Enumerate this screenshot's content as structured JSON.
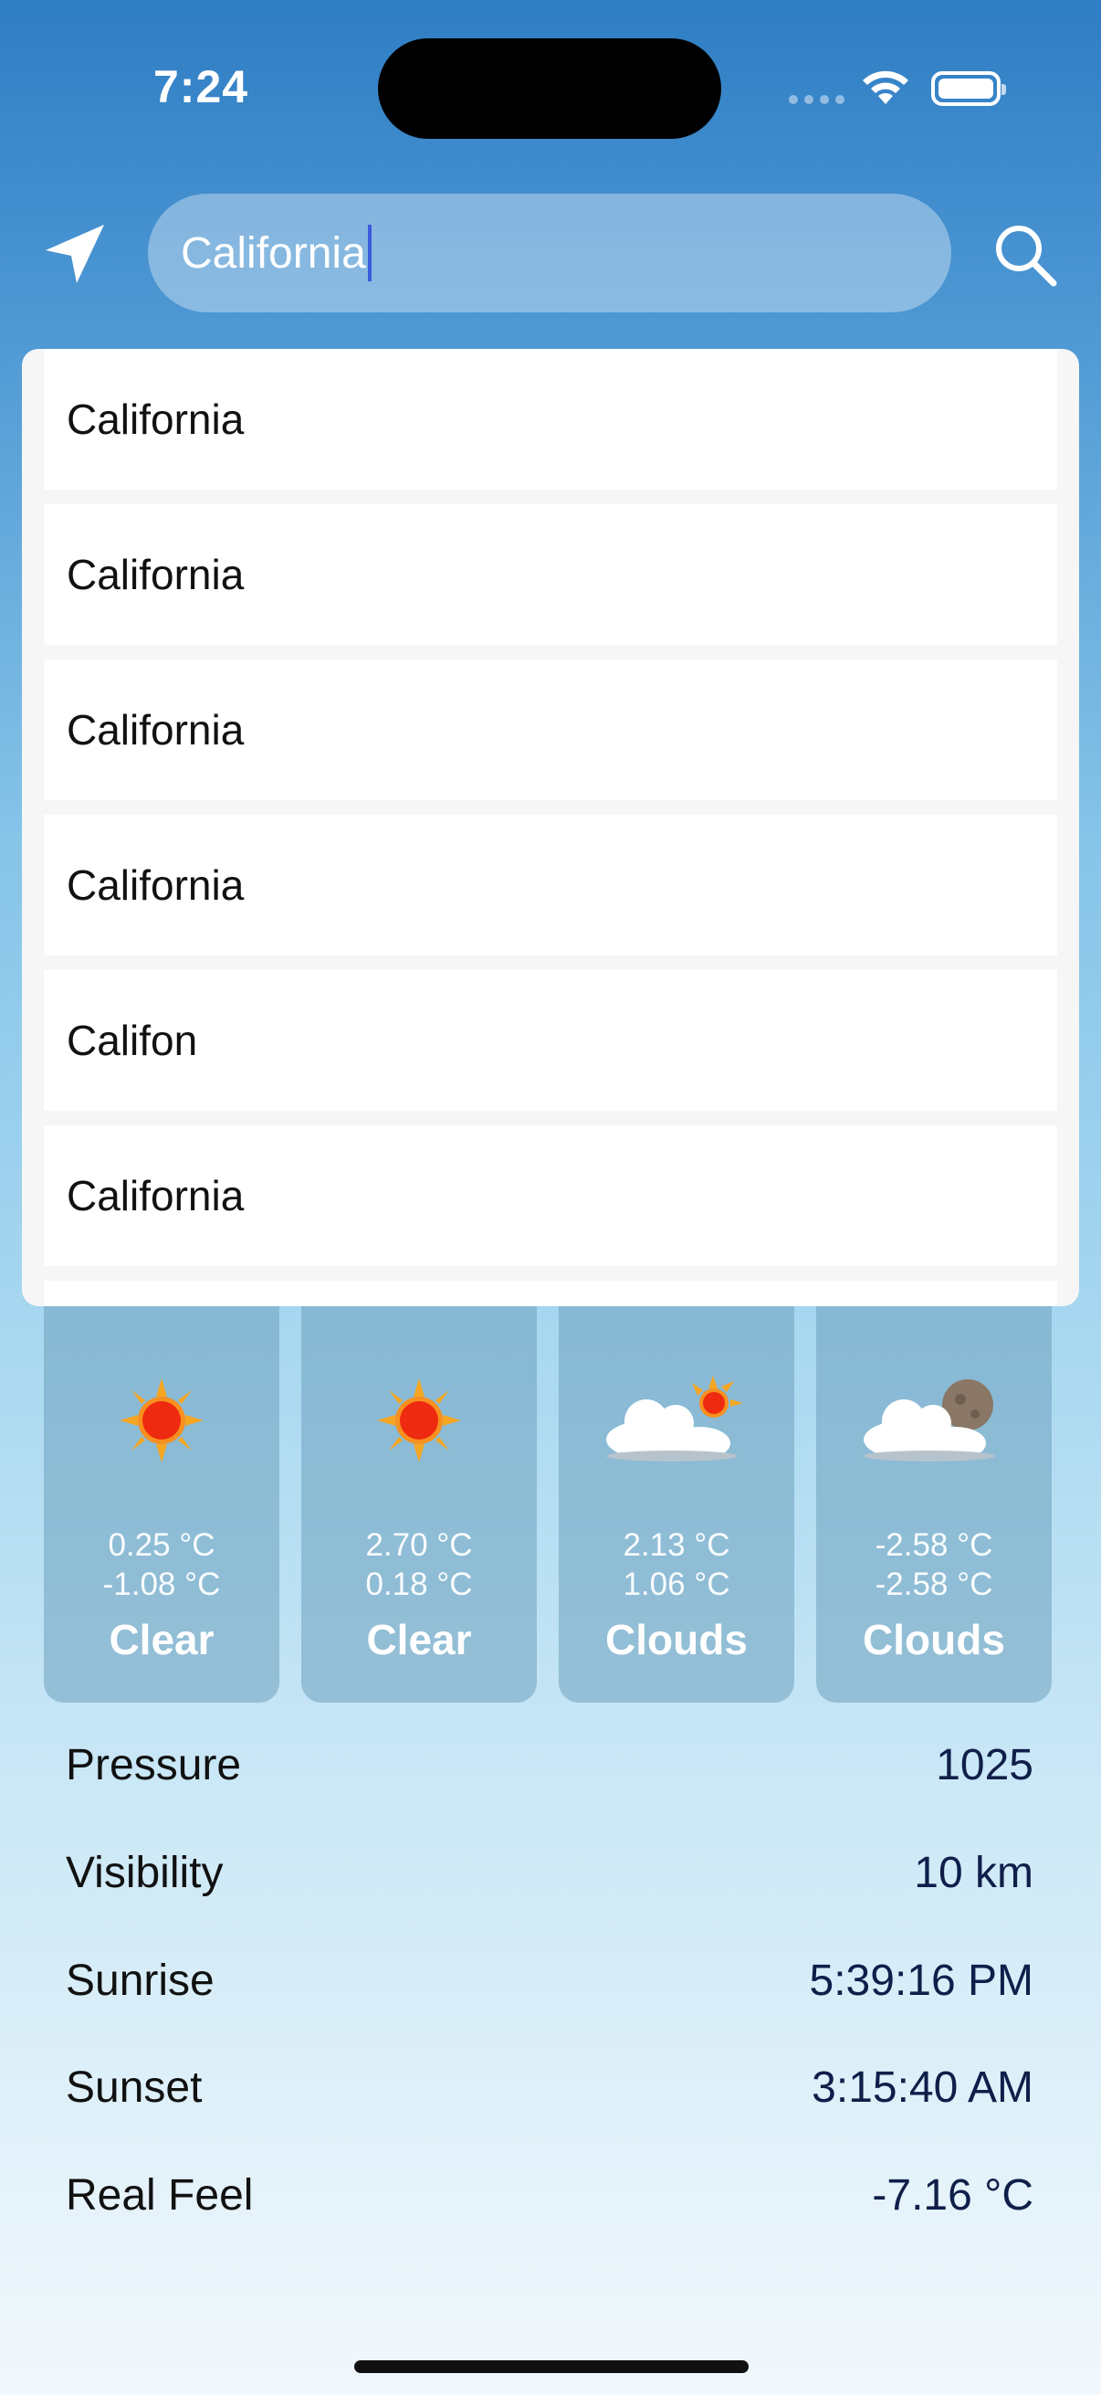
{
  "status": {
    "time": "7:24"
  },
  "search": {
    "value": "California"
  },
  "suggestions": [
    "California",
    "California",
    "California",
    "California",
    "Califon",
    "California"
  ],
  "forecast": [
    {
      "icon": "sun-icon",
      "high": "0.25 °C",
      "low": "-1.08 °C",
      "condition": "Clear"
    },
    {
      "icon": "sun-icon",
      "high": "2.70 °C",
      "low": "0.18 °C",
      "condition": "Clear"
    },
    {
      "icon": "cloud-sun-icon",
      "high": "2.13 °C",
      "low": "1.06 °C",
      "condition": "Clouds"
    },
    {
      "icon": "cloud-moon-icon",
      "high": "-2.58 °C",
      "low": "-2.58 °C",
      "condition": "Clouds"
    }
  ],
  "details": [
    {
      "label": "Pressure",
      "value": "1025"
    },
    {
      "label": "Visibility",
      "value": "10 km"
    },
    {
      "label": "Sunrise",
      "value": "5:39:16 PM"
    },
    {
      "label": "Sunset",
      "value": "3:15:40 AM"
    },
    {
      "label": "Real Feel",
      "value": "-7.16 °C"
    }
  ],
  "colors": {
    "accent": "#3b5bdb",
    "card": "#7aaec9",
    "text_dark": "#0f1f4a"
  }
}
